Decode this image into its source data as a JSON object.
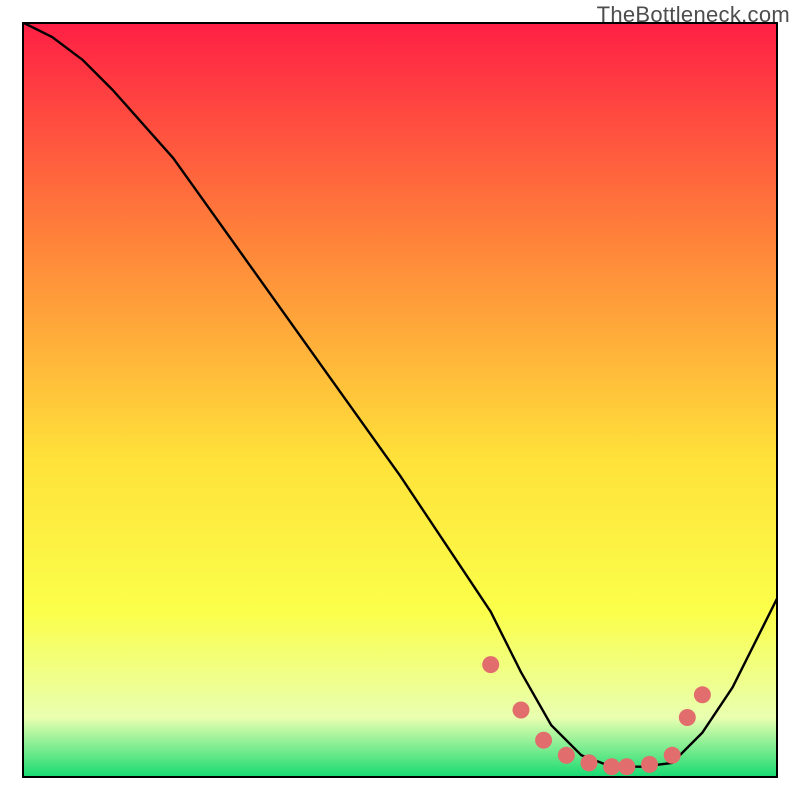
{
  "watermark": "TheBottleneck.com",
  "colors": {
    "gradient_top": "#ff1f45",
    "gradient_mid1": "#ff803a",
    "gradient_mid2": "#ffe23a",
    "gradient_mid3": "#fbff4a",
    "gradient_mid4": "#e9ffb0",
    "gradient_bottom": "#13da71",
    "curve": "#000000",
    "markers": "#e26d6d",
    "marker_stroke": "#c74a4a"
  },
  "chart_data": {
    "type": "line",
    "title": "",
    "xlabel": "",
    "ylabel": "",
    "xlim": [
      0,
      100
    ],
    "ylim": [
      0,
      100
    ],
    "series": [
      {
        "name": "bottleneck-curve",
        "x": [
          0,
          4,
          8,
          12,
          20,
          30,
          40,
          50,
          58,
          62,
          66,
          70,
          74,
          78,
          82,
          86,
          90,
          94,
          98,
          100
        ],
        "y": [
          100,
          98,
          95,
          91,
          82,
          68,
          54,
          40,
          28,
          22,
          14,
          7,
          3,
          1.5,
          1.5,
          2,
          6,
          12,
          20,
          24
        ]
      }
    ],
    "markers": {
      "name": "highlight-points",
      "x": [
        62,
        66,
        69,
        72,
        75,
        78,
        80,
        83,
        86,
        88,
        90
      ],
      "y": [
        15,
        9,
        5,
        3,
        2,
        1.5,
        1.5,
        1.8,
        3,
        8,
        11
      ]
    }
  }
}
